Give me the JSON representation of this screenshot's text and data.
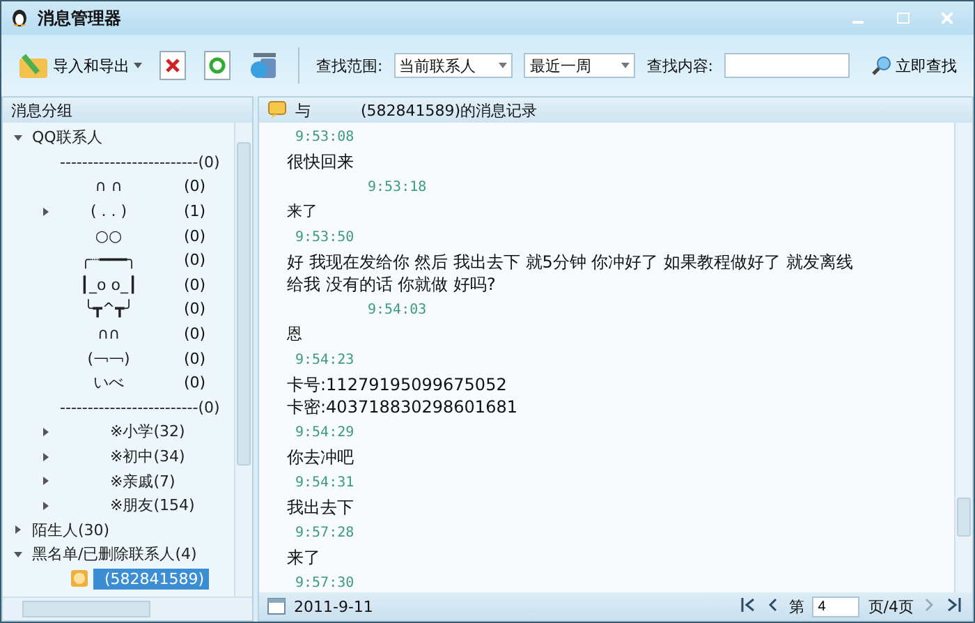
{
  "window": {
    "title": "消息管理器"
  },
  "toolbar": {
    "import_export": "导入和导出",
    "scope_label": "查找范围:",
    "scope": "当前联系人",
    "period": "最近一周",
    "content_label": "查找内容:",
    "search_button": "立即查找"
  },
  "sidebar": {
    "title": "消息分组",
    "tree": [
      {
        "name": "QQ联系人",
        "expanded": true,
        "children": [
          {
            "name": "-------------------------(0)"
          },
          {
            "name": "∩ ∩",
            "count": "(0)"
          },
          {
            "name": "( . . )",
            "count": "(1)",
            "expanded": false
          },
          {
            "name": "○○",
            "count": "(0)"
          },
          {
            "name": "╭┈━━━╮",
            "count": "(0)"
          },
          {
            "name": "┃_o o_┃",
            "count": "(0)"
          },
          {
            "name": "╰┳^┳╯",
            "count": "(0)"
          },
          {
            "name": "∩∩",
            "count": "(0)"
          },
          {
            "name": "(￢￢)",
            "count": "(0)"
          },
          {
            "name": "いべ",
            "count": "(0)"
          },
          {
            "name": "-------------------------(0)"
          },
          {
            "name": "※小学(32)",
            "expanded": false
          },
          {
            "name": "※初中(34)",
            "expanded": false
          },
          {
            "name": "※亲戚(7)",
            "expanded": false
          },
          {
            "name": "※朋友(154)",
            "expanded": false
          }
        ]
      },
      {
        "name": "陌生人(30)",
        "expanded": false
      },
      {
        "name": "黑名单/已删除联系人(4)",
        "expanded": true,
        "children": [
          {
            "name": "(582841589)",
            "selected": true
          }
        ]
      }
    ]
  },
  "conversation": {
    "title_prefix": "与",
    "title": "(582841589)的消息记录",
    "messages": [
      {
        "kind": "self",
        "time": "9:53:08",
        "lines": [
          "很快回来"
        ]
      },
      {
        "kind": "other",
        "time": "9:53:18",
        "lines": [
          "来了"
        ]
      },
      {
        "kind": "self",
        "time": "9:53:50",
        "lines": [
          "好  我现在发给你  然后  我出去下  就5分钟  你冲好了  如果教程做好了  就发离线",
          "给我  没有的话  你就做  好吗?"
        ]
      },
      {
        "kind": "other",
        "time": "9:54:03",
        "lines": [
          "恩"
        ]
      },
      {
        "kind": "self",
        "time": "9:54:23",
        "lines": [
          "卡号:11279195099675052",
          "卡密:403718830298601681"
        ]
      },
      {
        "kind": "self",
        "time": "9:54:29",
        "lines": [
          "你去冲吧"
        ]
      },
      {
        "kind": "self",
        "time": "9:54:31",
        "lines": [
          "我出去下"
        ]
      },
      {
        "kind": "self",
        "time": "9:57:28",
        "lines": [
          "来了"
        ]
      },
      {
        "kind": "self",
        "time": "9:57:30"
      }
    ]
  },
  "status_bar": {
    "date": "2011-9-11",
    "page_prefix": "第",
    "page": "4",
    "page_suffix": "页/4页"
  }
}
